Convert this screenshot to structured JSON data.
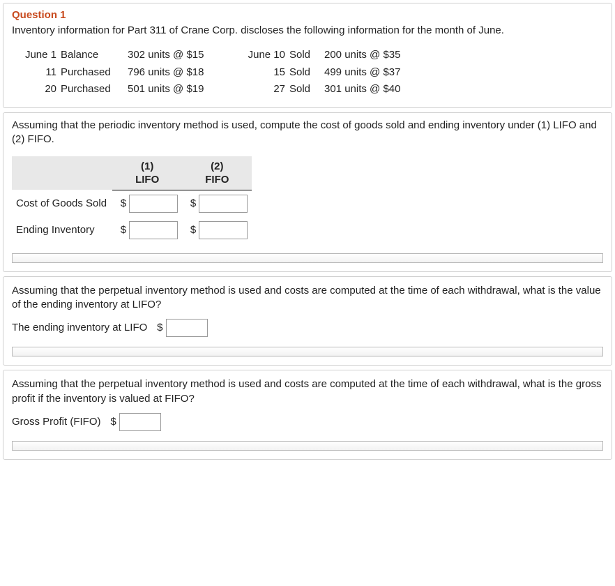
{
  "question": {
    "title": "Question 1",
    "intro": "Inventory information for Part 311 of Crane Corp. discloses the following information for the month of June."
  },
  "transactions": [
    {
      "ldate": "June 1",
      "ltype": "Balance",
      "lval": "302 units @ $15",
      "rdate": "June 10",
      "rtype": "Sold",
      "rval": "200 units @ $35"
    },
    {
      "ldate": "11",
      "ltype": "Purchased",
      "lval": "796 units @ $18",
      "rdate": "15",
      "rtype": "Sold",
      "rval": "499 units @ $37"
    },
    {
      "ldate": "20",
      "ltype": "Purchased",
      "lval": "501 units @ $19",
      "rdate": "27",
      "rtype": "Sold",
      "rval": "301 units @ $40"
    }
  ],
  "part1": {
    "inst": "Assuming that the periodic inventory method is used, compute the cost of goods sold and ending inventory under (1) LIFO and (2) FIFO.",
    "col1_top": "(1)",
    "col1_bot": "LIFO",
    "col2_top": "(2)",
    "col2_bot": "FIFO",
    "row1": "Cost of Goods Sold",
    "row2": "Ending Inventory",
    "dollar": "$"
  },
  "part2": {
    "inst": "Assuming that the perpetual inventory method is used and costs are computed at the time of each withdrawal, what is the value of the ending inventory at LIFO?",
    "label": "The ending inventory at LIFO",
    "dollar": "$"
  },
  "part3": {
    "inst": "Assuming that the perpetual inventory method is used and costs are computed at the time of each withdrawal, what is the gross profit if the inventory is valued at FIFO?",
    "label": "Gross Profit (FIFO)",
    "dollar": "$"
  }
}
